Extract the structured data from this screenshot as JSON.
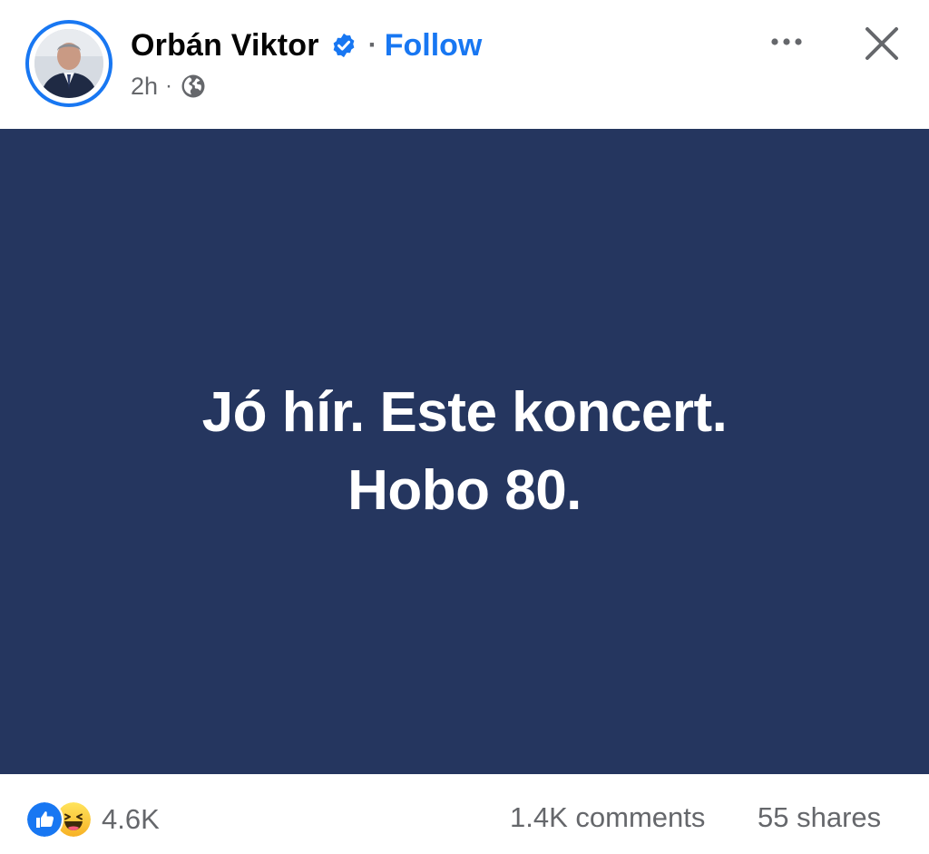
{
  "post": {
    "author": "Orbán Viktor",
    "separator": "·",
    "follow_label": "Follow",
    "time": "2h",
    "meta_separator": "·",
    "body_lines": [
      "Jó hír. Este koncert.",
      "Hobo 80."
    ],
    "card_color": "#25365f"
  },
  "icons": {
    "verified": "verified-badge-icon",
    "audience": "globe-icon",
    "more": "more-options-icon",
    "close": "close-icon",
    "like": "like-reaction-icon",
    "haha": "haha-reaction-icon"
  },
  "stats": {
    "reaction_count": "4.6K",
    "comments": "1.4K comments",
    "shares": "55 shares"
  },
  "colors": {
    "accent": "#1877f2",
    "secondary_text": "#65676b"
  }
}
